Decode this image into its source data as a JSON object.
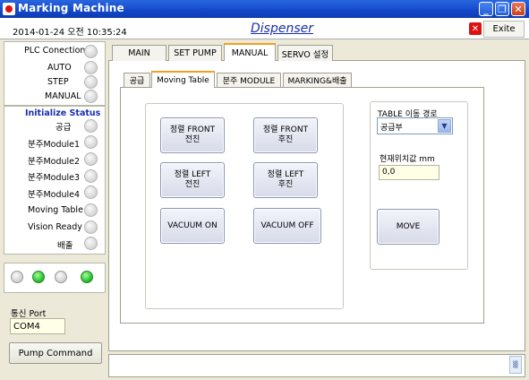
{
  "window": {
    "title": "Marking Machine",
    "controls": [
      "_",
      "❐",
      "✕"
    ]
  },
  "header": {
    "datetime": "2014-01-24 오전 10:35:24",
    "app_name": "Dispenser",
    "exit_label": "Exite"
  },
  "status": {
    "items": [
      {
        "label": "PLC Conection"
      },
      {
        "label": "AUTO"
      },
      {
        "label": "STEP"
      },
      {
        "label": "MANUAL"
      }
    ]
  },
  "init": {
    "title": "Initialize  Status",
    "items": [
      {
        "label": "공급"
      },
      {
        "label": "분주Module1"
      },
      {
        "label": "분주Module2"
      },
      {
        "label": "분주Module3"
      },
      {
        "label": "분주Module4"
      },
      {
        "label": "Moving Table"
      },
      {
        "label": "Vision Ready"
      },
      {
        "label": "배출"
      }
    ]
  },
  "leds": [
    {
      "state": "off"
    },
    {
      "state": "on"
    },
    {
      "state": "off"
    },
    {
      "state": "on"
    }
  ],
  "port": {
    "label": "통신 Port",
    "value": "COM4"
  },
  "pump_button": "Pump Command",
  "main_tabs": [
    {
      "label": "MAIN"
    },
    {
      "label": "SET PUMP"
    },
    {
      "label": "MANUAL"
    },
    {
      "label": "SERVO 설정"
    }
  ],
  "active_main_tab": "MANUAL",
  "sub_tabs": [
    {
      "label": "공급"
    },
    {
      "label": "Moving Table"
    },
    {
      "label": "분주 MODULE"
    },
    {
      "label": "MARKING&배출"
    }
  ],
  "active_sub_tab": "Moving Table",
  "controls": {
    "front_forward": {
      "line1": "정렬 FRONT",
      "line2": "전진"
    },
    "front_back": {
      "line1": "정렬 FRONT",
      "line2": "후진"
    },
    "left_forward": {
      "line1": "정렬 LEFT",
      "line2": "전진"
    },
    "left_back": {
      "line1": "정렬 LEFT",
      "line2": "후진"
    },
    "vacuum_on": "VACUUM ON",
    "vacuum_off": "VACUUM OFF"
  },
  "route": {
    "label": "TABLE 이동 경로",
    "selected": "공급부",
    "position_label": "현재위치값  mm",
    "position_value": "0,0",
    "move_label": "MOVE"
  },
  "colors": {
    "titlebar": "#1247c8",
    "heading": "#1a2fb0",
    "active_tab_accent": "#f0a020",
    "led_on": "#22b522"
  }
}
